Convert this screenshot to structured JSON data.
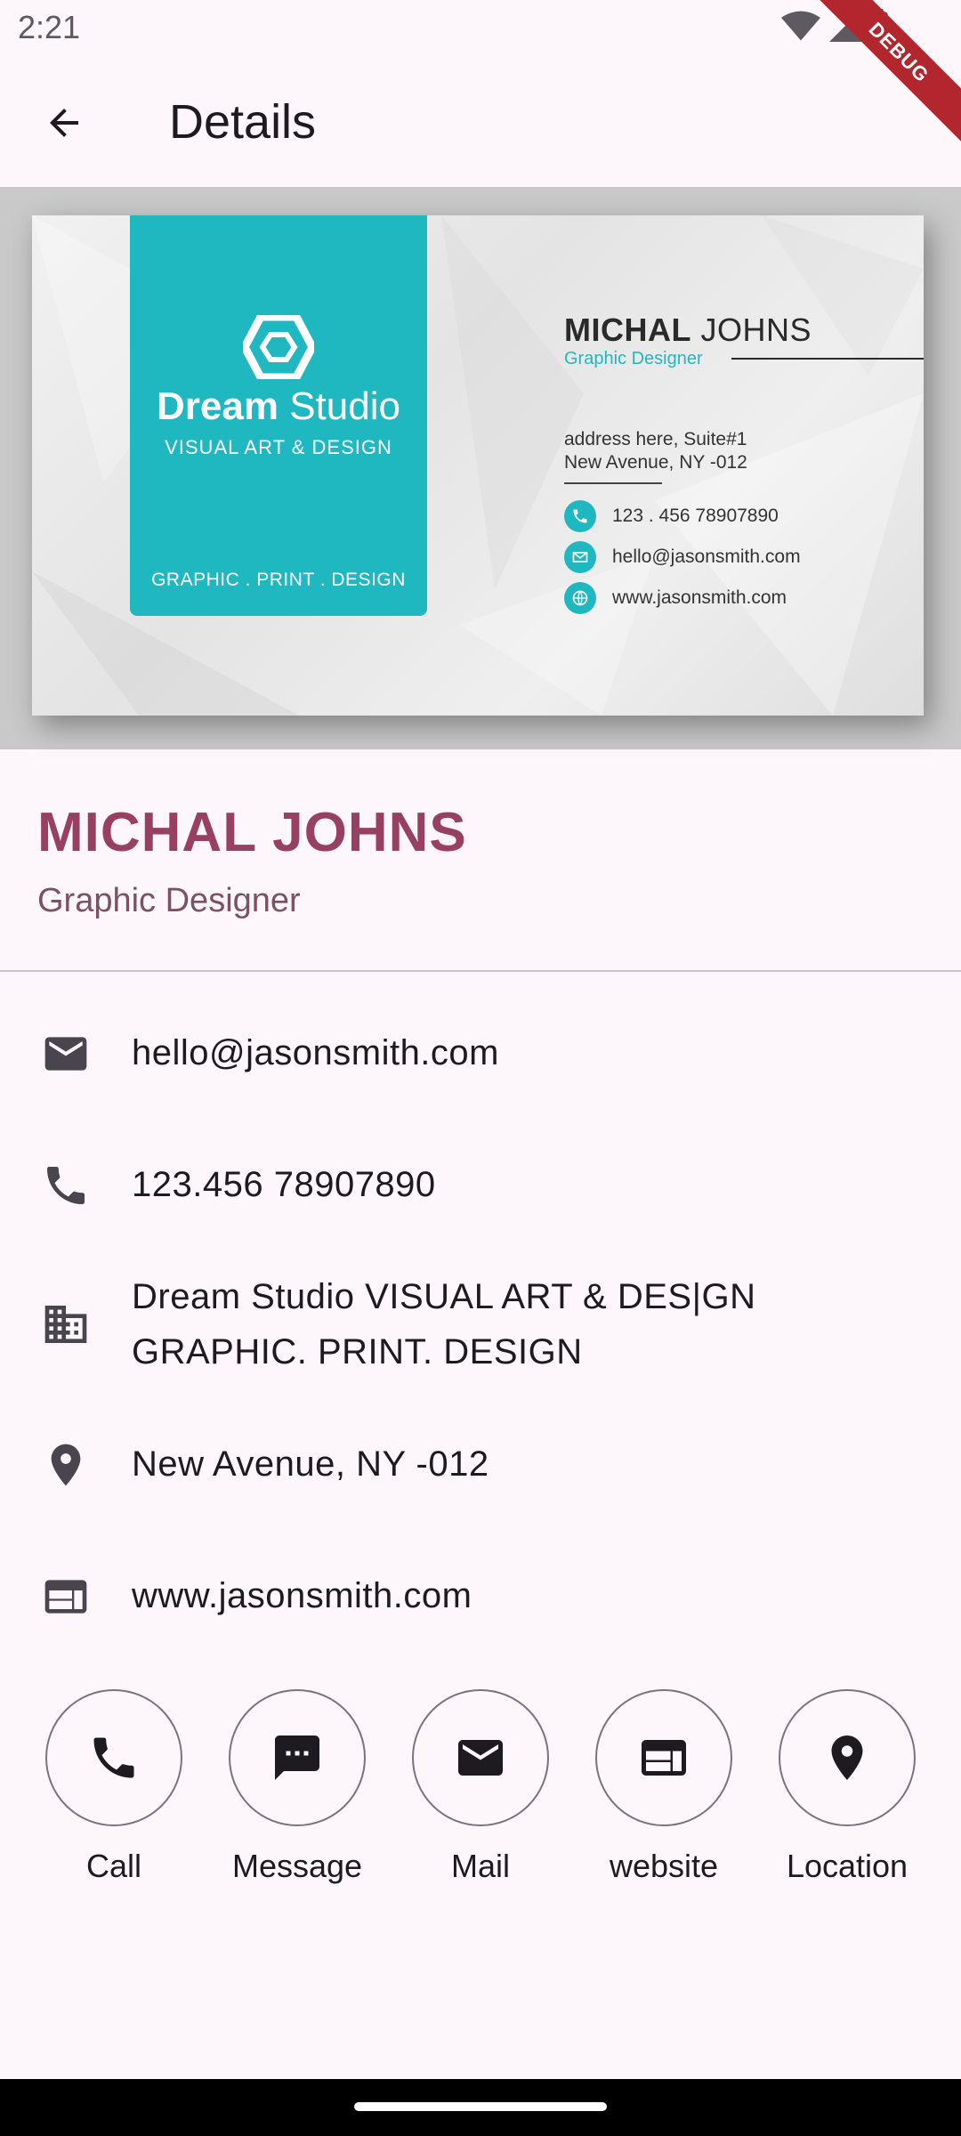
{
  "status": {
    "time": "2:21",
    "debug_label": "DEBUG"
  },
  "appbar": {
    "title": "Details"
  },
  "card": {
    "brand_bold": "Dream",
    "brand_rest": " Studio",
    "brand_sub": "VISUAL ART & DESIGN",
    "brand_foot": "GRAPHIC . PRINT . DESIGN",
    "name_bold": "MICHAL",
    "name_rest": " JOHNS",
    "role": "Graphic Designer",
    "address_line1": "address here, Suite#1",
    "address_line2": "New Avenue, NY -012",
    "phone": "123 . 456  78907890",
    "email": "hello@jasonsmith.com",
    "website": "www.jasonsmith.com",
    "accent_color": "#1fb8c1"
  },
  "person": {
    "name": "MICHAL JOHNS",
    "role": "Graphic Designer",
    "name_color": "#984061"
  },
  "details": {
    "email": "hello@jasonsmith.com",
    "phone": "123.456 78907890",
    "company_line1": "Dream Studio VISUAL ART & DES|GN",
    "company_line2": "GRAPHIC. PRINT. DESIGN",
    "address": "New Avenue, NY -012",
    "website": "www.jasonsmith.com"
  },
  "actions": {
    "call": "Call",
    "message": "Message",
    "mail": "Mail",
    "website": "website",
    "location": "Location"
  }
}
